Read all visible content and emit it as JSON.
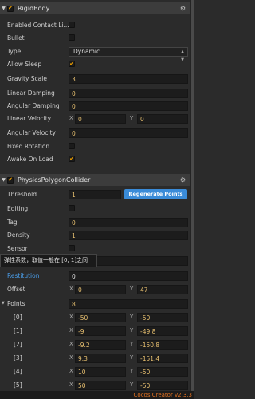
{
  "rigidbody": {
    "title": "RigidBody",
    "enabled": true,
    "props": {
      "enabled_contact_listener": {
        "label": "Enabled Contact Li...",
        "checked": false
      },
      "bullet": {
        "label": "Bullet",
        "checked": false
      },
      "type": {
        "label": "Type",
        "value": "Dynamic"
      },
      "allow_sleep": {
        "label": "Allow Sleep",
        "checked": true
      },
      "gravity_scale": {
        "label": "Gravity Scale",
        "value": "3"
      },
      "linear_damping": {
        "label": "Linear Damping",
        "value": "0"
      },
      "angular_damping": {
        "label": "Angular Damping",
        "value": "0"
      },
      "linear_velocity": {
        "label": "Linear Velocity",
        "x_label": "X",
        "x": "0",
        "y_label": "Y",
        "y": "0"
      },
      "angular_velocity": {
        "label": "Angular Velocity",
        "value": "0"
      },
      "fixed_rotation": {
        "label": "Fixed Rotation",
        "checked": false
      },
      "awake_on_load": {
        "label": "Awake On Load",
        "checked": true
      }
    }
  },
  "collider": {
    "title": "PhysicsPolygonCollider",
    "enabled": true,
    "props": {
      "threshold": {
        "label": "Threshold",
        "value": "1"
      },
      "regenerate_label": "Regenerate Points",
      "editing": {
        "label": "Editing",
        "checked": false
      },
      "tag": {
        "label": "Tag",
        "value": "0"
      },
      "density": {
        "label": "Density",
        "value": "1"
      },
      "sensor": {
        "label": "Sensor",
        "checked": false
      },
      "restitution": {
        "label": "Restitution",
        "value": "0"
      },
      "offset": {
        "label": "Offset",
        "x_label": "X",
        "x": "0",
        "y_label": "Y",
        "y": "47"
      },
      "points": {
        "label": "Points",
        "count": "8"
      }
    },
    "points": [
      {
        "label": "[0]",
        "x": "-50",
        "y": "-50"
      },
      {
        "label": "[1]",
        "x": "-9",
        "y": "-49.8"
      },
      {
        "label": "[2]",
        "x": "-9.2",
        "y": "-150.8"
      },
      {
        "label": "[3]",
        "x": "9.3",
        "y": "-151.4"
      },
      {
        "label": "[4]",
        "x": "10",
        "y": "-50"
      },
      {
        "label": "[5]",
        "x": "50",
        "y": "-50"
      }
    ]
  },
  "tooltip": "弹性系数，取值一般在 [0, 1]之间",
  "footer": {
    "version": "Cocos Creator v2.3.3"
  },
  "colors": {
    "accent": "#3a8bd8",
    "value_text": "#e8c070",
    "checkmark": "#f0a000",
    "highlight_label": "#4a9de8",
    "version_text": "#e07020"
  }
}
